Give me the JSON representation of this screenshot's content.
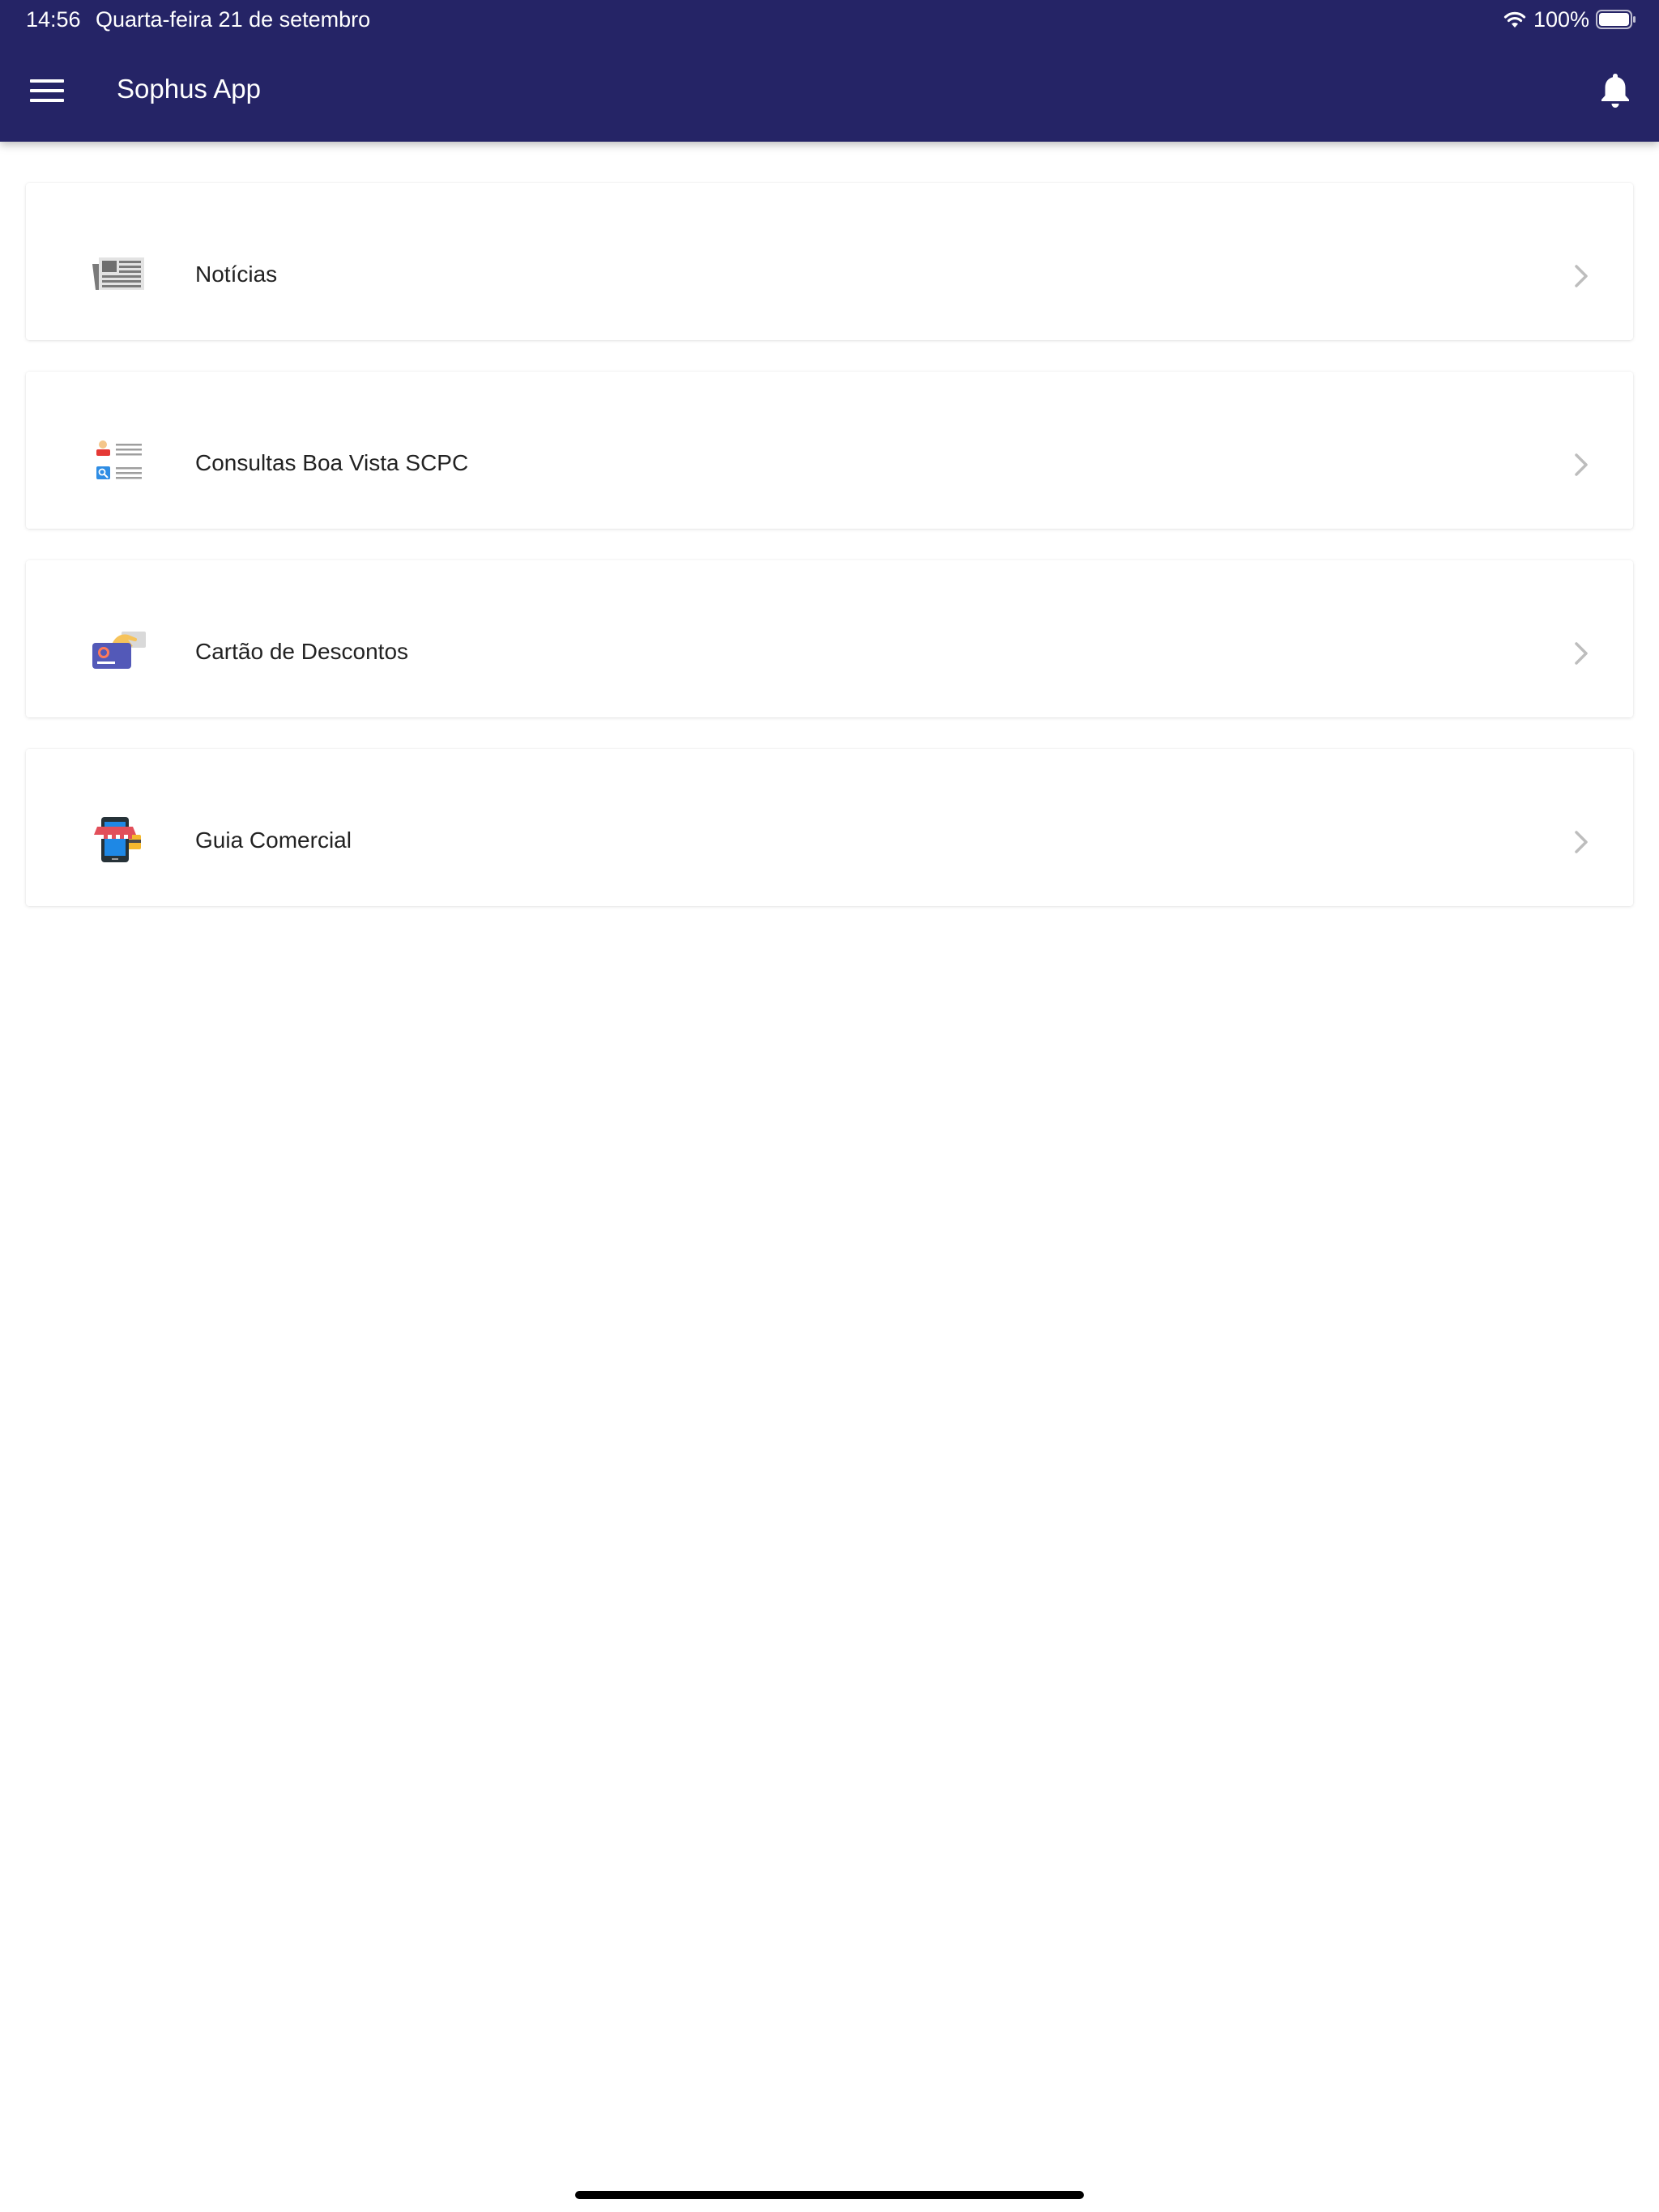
{
  "status_bar": {
    "time": "14:56",
    "date": "Quarta-feira 21 de setembro",
    "battery": "100%"
  },
  "header": {
    "title": "Sophus App",
    "bg_color": "#252466"
  },
  "menu": {
    "items": [
      {
        "label": "Notícias",
        "icon": "newspaper-icon"
      },
      {
        "label": "Consultas Boa Vista SCPC",
        "icon": "consult-list-icon"
      },
      {
        "label": "Cartão de Descontos",
        "icon": "discount-card-icon"
      },
      {
        "label": "Guia Comercial",
        "icon": "store-phone-icon"
      }
    ]
  }
}
